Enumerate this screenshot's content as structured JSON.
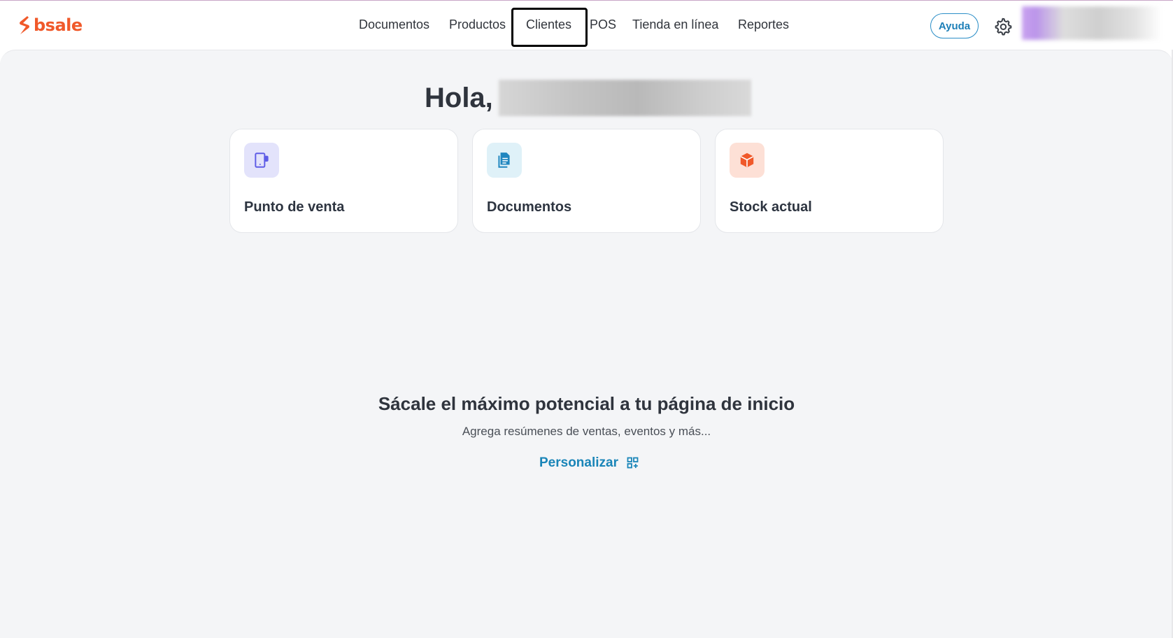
{
  "brand": {
    "logo_text": "bsale",
    "accent": "#f0592a"
  },
  "nav": {
    "items": [
      {
        "label": "Documentos"
      },
      {
        "label": "Productos"
      },
      {
        "label": "Clientes"
      },
      {
        "label": "POS"
      },
      {
        "label": "Tienda en línea"
      },
      {
        "label": "Reportes"
      }
    ],
    "highlighted": "Clientes"
  },
  "header": {
    "help_label": "Ayuda",
    "settings_icon": "gear-icon"
  },
  "main": {
    "greeting": "Hola,",
    "cards": [
      {
        "label": "Punto de venta",
        "icon": "pos-device-icon",
        "icon_bg": "#e3e3fb",
        "icon_color": "#5e5ce6"
      },
      {
        "label": "Documentos",
        "icon": "document-icon",
        "icon_bg": "#dff1f8",
        "icon_color": "#1f86bf"
      },
      {
        "label": "Stock actual",
        "icon": "box-icon",
        "icon_bg": "#fde0d6",
        "icon_color": "#f0592a"
      }
    ],
    "promo": {
      "title": "Sácale el máximo potencial a tu página de inicio",
      "subtitle": "Agrega resúmenes de ventas, eventos y más...",
      "customize_label": "Personalizar",
      "customize_icon": "widgets-add-icon"
    }
  }
}
